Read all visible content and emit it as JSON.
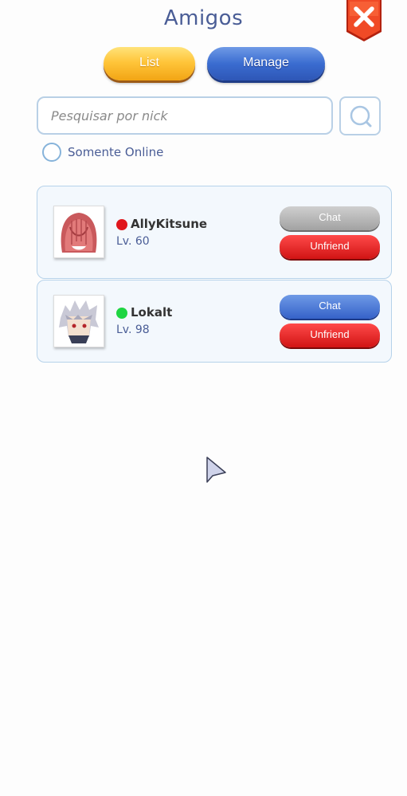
{
  "header": {
    "title": "Amigos"
  },
  "tabs": [
    {
      "label": "List"
    },
    {
      "label": "Manage"
    }
  ],
  "search": {
    "placeholder": "Pesquisar por nick",
    "value": ""
  },
  "filter": {
    "online_only_label": "Somente Online",
    "checked": false
  },
  "friends": [
    {
      "name": "AllyKitsune",
      "level": "Lv. 60",
      "status_color": "#e0161c",
      "chat_label": "Chat",
      "chat_enabled": false,
      "unfriend_label": "Unfriend"
    },
    {
      "name": "Lokalt",
      "level": "Lv. 98",
      "status_color": "#1fd542",
      "chat_label": "Chat",
      "chat_enabled": true,
      "unfriend_label": "Unfriend"
    }
  ],
  "icons": {
    "close": "close-icon",
    "search": "search-icon",
    "cursor": "pointer-cursor-icon"
  },
  "colors": {
    "title": "#4a5d96",
    "tab_list": "#ffc53a",
    "tab_manage": "#3a6cd0",
    "unfriend": "#d11414",
    "card_border": "#b6d2ea"
  }
}
